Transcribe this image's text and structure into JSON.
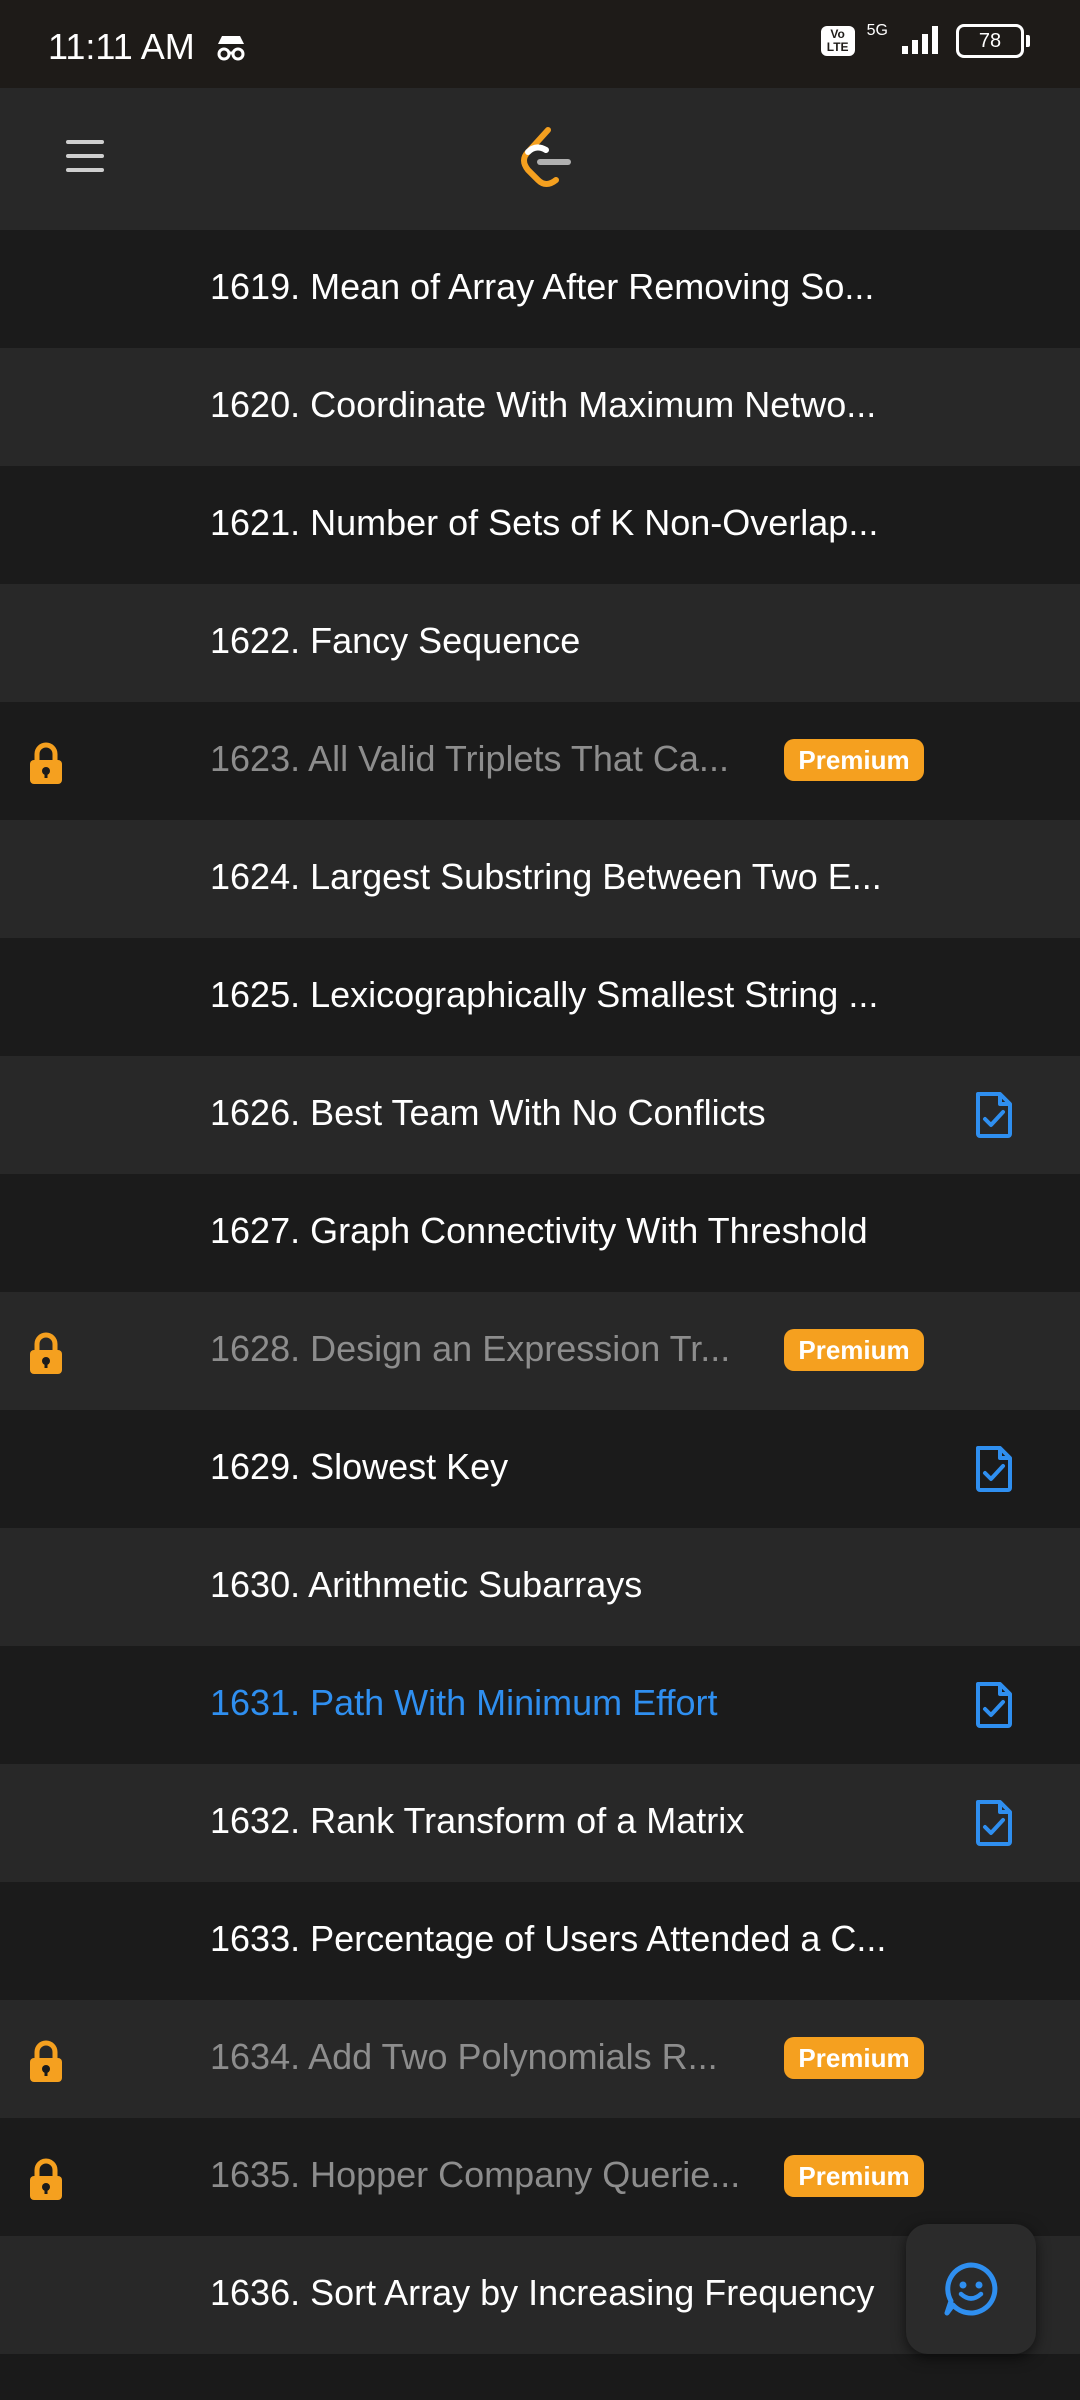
{
  "status_bar": {
    "time": "11:11 AM",
    "icons": [
      "incognito-icon",
      "volte-icon",
      "signal-5g-icon",
      "battery-icon"
    ],
    "volte_label": "Vo LTE",
    "network_label": "5G",
    "battery_level": "78"
  },
  "header": {
    "menu_icon": "hamburger-icon",
    "logo_icon": "leetcode-logo-icon"
  },
  "problems": [
    {
      "title": "1619. Mean of Array After Removing So...",
      "locked": false,
      "premium": false,
      "solved": false,
      "highlight": false
    },
    {
      "title": "1620. Coordinate With Maximum Netwo...",
      "locked": false,
      "premium": false,
      "solved": false,
      "highlight": false
    },
    {
      "title": "1621. Number of Sets of K Non-Overlap...",
      "locked": false,
      "premium": false,
      "solved": false,
      "highlight": false
    },
    {
      "title": "1622. Fancy Sequence",
      "locked": false,
      "premium": false,
      "solved": false,
      "highlight": false
    },
    {
      "title": "1623. All Valid Triplets That Ca...",
      "locked": true,
      "premium": true,
      "solved": false,
      "highlight": false
    },
    {
      "title": "1624. Largest Substring Between Two E...",
      "locked": false,
      "premium": false,
      "solved": false,
      "highlight": false
    },
    {
      "title": "1625. Lexicographically Smallest String ...",
      "locked": false,
      "premium": false,
      "solved": false,
      "highlight": false
    },
    {
      "title": "1626. Best Team With No Conflicts",
      "locked": false,
      "premium": false,
      "solved": true,
      "highlight": false
    },
    {
      "title": "1627. Graph Connectivity With Threshold",
      "locked": false,
      "premium": false,
      "solved": false,
      "highlight": false
    },
    {
      "title": "1628. Design an Expression Tr...",
      "locked": true,
      "premium": true,
      "solved": false,
      "highlight": false
    },
    {
      "title": "1629. Slowest Key",
      "locked": false,
      "premium": false,
      "solved": true,
      "highlight": false
    },
    {
      "title": "1630. Arithmetic Subarrays",
      "locked": false,
      "premium": false,
      "solved": false,
      "highlight": false
    },
    {
      "title": "1631. Path With Minimum Effort",
      "locked": false,
      "premium": false,
      "solved": true,
      "highlight": true
    },
    {
      "title": "1632. Rank Transform of a Matrix",
      "locked": false,
      "premium": false,
      "solved": true,
      "highlight": false
    },
    {
      "title": "1633. Percentage of Users Attended a C...",
      "locked": false,
      "premium": false,
      "solved": false,
      "highlight": false
    },
    {
      "title": "1634. Add Two Polynomials R...",
      "locked": true,
      "premium": true,
      "solved": false,
      "highlight": false
    },
    {
      "title": "1635. Hopper Company Querie...",
      "locked": true,
      "premium": true,
      "solved": false,
      "highlight": false
    },
    {
      "title": "1636. Sort Array by Increasing Frequency",
      "locked": false,
      "premium": false,
      "solved": false,
      "highlight": false
    }
  ],
  "premium_label": "Premium",
  "chat_button_icon": "chat-smile-icon",
  "colors": {
    "accent_orange": "#f5a01f",
    "link_blue": "#2f8ff0",
    "row_dark": "#1b1b1b",
    "row_light": "#282828"
  }
}
